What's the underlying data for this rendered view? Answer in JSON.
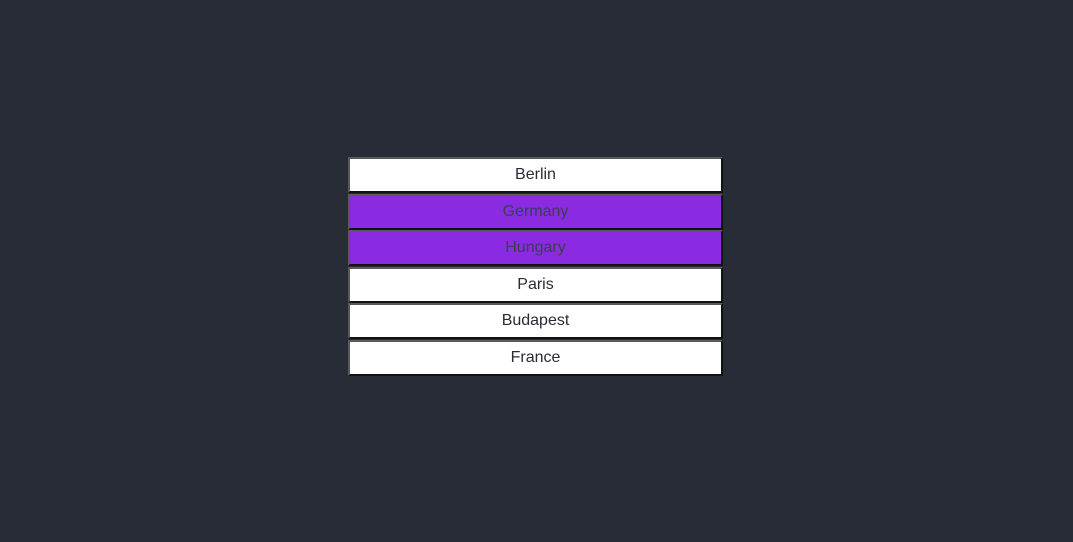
{
  "colors": {
    "background": "#282c36",
    "selected_fill": "#8a2be2",
    "unselected_fill": "#ffffff",
    "text": "#282c36"
  },
  "items": [
    {
      "label": "Berlin",
      "selected": false
    },
    {
      "label": "Germany",
      "selected": true
    },
    {
      "label": "Hungary",
      "selected": true
    },
    {
      "label": "Paris",
      "selected": false
    },
    {
      "label": "Budapest",
      "selected": false
    },
    {
      "label": "France",
      "selected": false
    }
  ]
}
